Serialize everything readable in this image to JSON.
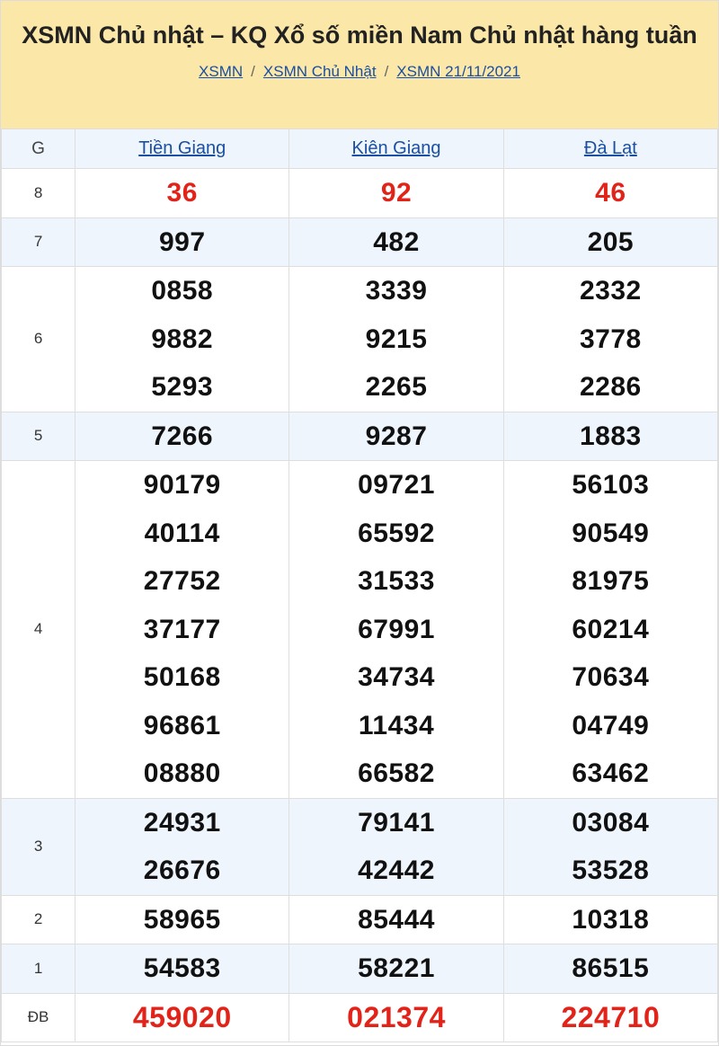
{
  "header": {
    "title": "XSMN Chủ nhật – KQ Xổ số miền Nam Chủ nhật hàng tuần",
    "breadcrumb": [
      "XSMN",
      "XSMN Chủ Nhật",
      "XSMN 21/11/2021"
    ],
    "breadcrumb_sep": "/"
  },
  "table": {
    "col_label": "G",
    "provinces": [
      "Tiền Giang",
      "Kiên Giang",
      "Đà Lạt"
    ],
    "rows": [
      {
        "label": "8",
        "values": [
          [
            "36"
          ],
          [
            "92"
          ],
          [
            "46"
          ]
        ]
      },
      {
        "label": "7",
        "values": [
          [
            "997"
          ],
          [
            "482"
          ],
          [
            "205"
          ]
        ]
      },
      {
        "label": "6",
        "values": [
          [
            "0858",
            "9882",
            "5293"
          ],
          [
            "3339",
            "9215",
            "2265"
          ],
          [
            "2332",
            "3778",
            "2286"
          ]
        ]
      },
      {
        "label": "5",
        "values": [
          [
            "7266"
          ],
          [
            "9287"
          ],
          [
            "1883"
          ]
        ]
      },
      {
        "label": "4",
        "values": [
          [
            "90179",
            "40114",
            "27752",
            "37177",
            "50168",
            "96861",
            "08880"
          ],
          [
            "09721",
            "65592",
            "31533",
            "67991",
            "34734",
            "11434",
            "66582"
          ],
          [
            "56103",
            "90549",
            "81975",
            "60214",
            "70634",
            "04749",
            "63462"
          ]
        ]
      },
      {
        "label": "3",
        "values": [
          [
            "24931",
            "26676"
          ],
          [
            "79141",
            "42442"
          ],
          [
            "03084",
            "53528"
          ]
        ]
      },
      {
        "label": "2",
        "values": [
          [
            "58965"
          ],
          [
            "85444"
          ],
          [
            "10318"
          ]
        ]
      },
      {
        "label": "1",
        "values": [
          [
            "54583"
          ],
          [
            "58221"
          ],
          [
            "86515"
          ]
        ]
      },
      {
        "label": "ĐB",
        "values": [
          [
            "459020"
          ],
          [
            "021374"
          ],
          [
            "224710"
          ]
        ]
      }
    ]
  },
  "colors": {
    "header_bg": "#fbe7a7",
    "row_alt_bg": "#eef5fc",
    "highlight_red": "#e2231a",
    "link_blue": "#1a4fa3"
  }
}
